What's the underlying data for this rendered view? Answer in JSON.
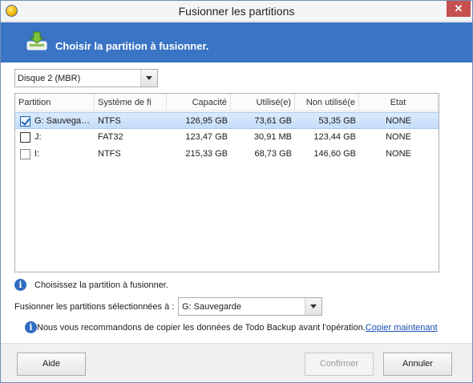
{
  "window": {
    "title": "Fusionner les partitions",
    "close_label": "✕"
  },
  "banner": {
    "heading": "Choisir la partition à fusionner.",
    "icon": "merge-arrow-down-icon",
    "color": "#3a74c4"
  },
  "disk_select": {
    "value": "Disque 2 (MBR)"
  },
  "table": {
    "columns": [
      "Partition",
      "Système de fi",
      "Capacité",
      "Utilisé(e)",
      "Non utilisé(e",
      "Etat"
    ],
    "rows": [
      {
        "checked": true,
        "partition": "G: Sauvegarde",
        "fs": "NTFS",
        "capacity": "126,95 GB",
        "used": "73,61 GB",
        "unused": "53,35 GB",
        "state": "NONE"
      },
      {
        "checked": false,
        "partition": "J:",
        "fs": "FAT32",
        "capacity": "123,47 GB",
        "used": "30,91 MB",
        "unused": "123,44 GB",
        "state": "NONE"
      },
      {
        "checked": false,
        "partition": "I:",
        "fs": "NTFS",
        "capacity": "215,33 GB",
        "used": "68,73 GB",
        "unused": "146,60 GB",
        "state": "NONE"
      }
    ]
  },
  "hint": {
    "text": "Choisissez la partition à fusionner."
  },
  "merge_target": {
    "label": "Fusionner les partitions sélectionnées à :",
    "value": "G: Sauvegarde"
  },
  "recommendation": {
    "text": "Nous vous recommandons de copier les données de Todo Backup  avant l'opération.",
    "link": "Copier maintenant"
  },
  "footer": {
    "help": "Aide",
    "confirm": "Confirmer",
    "cancel": "Annuler"
  }
}
